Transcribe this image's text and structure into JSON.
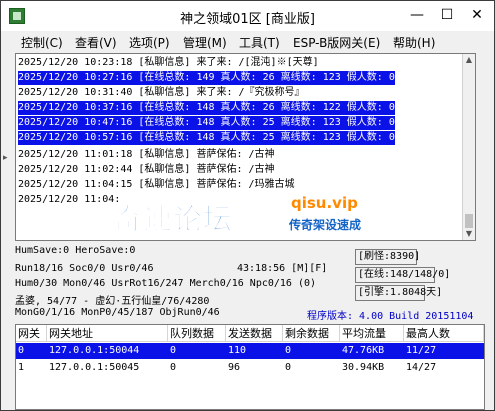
{
  "window": {
    "title": "神之领域01区 [商业版]",
    "minimize": "—",
    "maximize": "☐",
    "close": "✕"
  },
  "menu": [
    "控制(C)",
    "查看(V)",
    "选项(P)",
    "管理(M)",
    "工具(T)",
    "ESP-B版网关(E)",
    "帮助(H)"
  ],
  "log_lines": [
    {
      "text": "2025/12/20 10:23:18 [私聊信息] 来了来: /[混沌]※[天尊]",
      "highlight": false
    },
    {
      "text": "2025/12/20 10:27:16 [在线总数: 149 真人数: 26 离线数: 123 假人数: 0",
      "highlight": true
    },
    {
      "text": "2025/12/20 10:31:40 [私聊信息] 来了来: /『究极称号』",
      "highlight": false
    },
    {
      "text": "2025/12/20 10:37:16 [在线总数: 148 真人数: 26 离线数: 122 假人数: 0",
      "highlight": true
    },
    {
      "text": "2025/12/20 10:47:16 [在线总数: 148 真人数: 25 离线数: 123 假人数: 0",
      "highlight": true
    },
    {
      "text": "2025/12/20 10:57:16 [在线总数: 148 真人数: 25 离线数: 123 假人数: 0",
      "highlight": true
    },
    {
      "text": "2025/12/20 11:01:18 [私聊信息] 菩萨保佑: /古神",
      "highlight": false
    },
    {
      "text": "2025/12/20 11:02:44 [私聊信息] 菩萨保佑: /古神",
      "highlight": false
    },
    {
      "text": "2025/12/20 11:04:15 [私聊信息] 菩萨保佑: /玛雅古城",
      "highlight": false
    },
    {
      "text": "2025/12/20 11:04:",
      "highlight": false
    }
  ],
  "watermark": {
    "brand": "奇速论坛",
    "url": "qisu.vip",
    "slogan": "传奇架设速成"
  },
  "status": {
    "line1": "HumSave:0 HeroSave:0",
    "line2": "Run18/16 Soc0/0 Usr0/46",
    "time": "43:18:56 [M][F]",
    "line3": "Hum0/30 Mon0/46 UsrRot16/247 Merch0/16 Npc0/16 (0)",
    "line4": "孟婆, 54/77 - 虚幻·五行仙皇/76/4280",
    "line5": "MonG0/1/16 MonP0/45/187 ObjRun0/46",
    "refresh": "[刷怪:8390]",
    "online": "[在线:148/148/0]",
    "engine": "[引擎:1.8048天]",
    "version": "程序版本: 4.00 Build 20151104"
  },
  "table": {
    "headers": [
      "网关",
      "网关地址",
      "队列数据",
      "发送数据",
      "剩余数据",
      "平均流量",
      "最高人数"
    ],
    "rows": [
      {
        "cells": [
          "0",
          "127.0.0.1:50044",
          "0",
          "110",
          "0",
          "47.76KB",
          "11/27"
        ],
        "selected": true
      },
      {
        "cells": [
          "1",
          "127.0.0.1:50045",
          "0",
          "96",
          "0",
          "30.94KB",
          "14/27"
        ],
        "selected": false
      }
    ]
  }
}
